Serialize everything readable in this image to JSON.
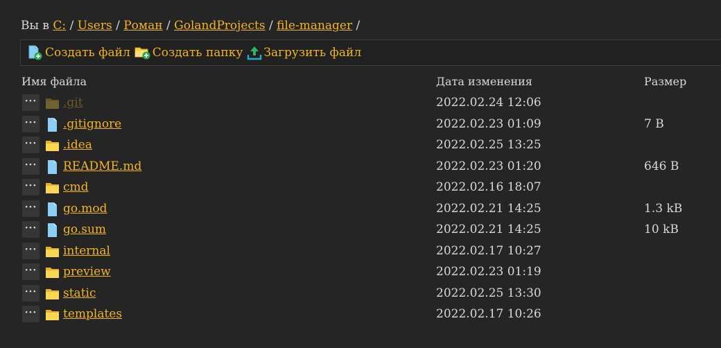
{
  "breadcrumb": {
    "prefix": "Вы в",
    "parts": [
      "C:",
      "Users",
      "Роман",
      "GolandProjects",
      "file-manager"
    ],
    "separator": "/"
  },
  "toolbar": {
    "create_file": "Создать файл",
    "create_folder": "Создать папку",
    "upload_file": "Загрузить файл"
  },
  "table": {
    "headers": {
      "name": "Имя файла",
      "modified": "Дата изменения",
      "size": "Размер"
    },
    "more_label": "···",
    "rows": [
      {
        "name": ".git",
        "type": "folder",
        "modified": "2022.02.24 12:06",
        "size": "",
        "hidden": true
      },
      {
        "name": ".gitignore",
        "type": "file",
        "modified": "2022.02.23 01:09",
        "size": "7 B",
        "hidden": false
      },
      {
        "name": ".idea",
        "type": "folder",
        "modified": "2022.02.25 13:25",
        "size": "",
        "hidden": false
      },
      {
        "name": "README.md",
        "type": "file",
        "modified": "2022.02.23 01:20",
        "size": "646 B",
        "hidden": false
      },
      {
        "name": "cmd",
        "type": "folder",
        "modified": "2022.02.16 18:07",
        "size": "",
        "hidden": false
      },
      {
        "name": "go.mod",
        "type": "file",
        "modified": "2022.02.21 14:25",
        "size": "1.3 kB",
        "hidden": false
      },
      {
        "name": "go.sum",
        "type": "file",
        "modified": "2022.02.21 14:25",
        "size": "10 kB",
        "hidden": false
      },
      {
        "name": "internal",
        "type": "folder",
        "modified": "2022.02.17 10:27",
        "size": "",
        "hidden": false
      },
      {
        "name": "preview",
        "type": "folder",
        "modified": "2022.02.23 01:19",
        "size": "",
        "hidden": false
      },
      {
        "name": "static",
        "type": "folder",
        "modified": "2022.02.25 13:30",
        "size": "",
        "hidden": false
      },
      {
        "name": "templates",
        "type": "folder",
        "modified": "2022.02.17 10:26",
        "size": "",
        "hidden": false
      }
    ]
  },
  "colors": {
    "background": "#252525",
    "link": "#f3b425",
    "text": "#d9d9d9",
    "folder_icon": "#f5cf3c",
    "file_icon": "#7cc4f0"
  }
}
